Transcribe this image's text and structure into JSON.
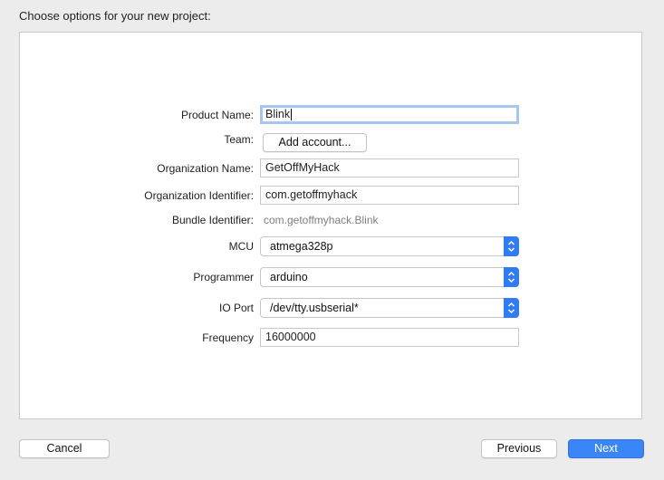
{
  "dialog": {
    "title": "Choose options for your new project:"
  },
  "form": {
    "product_name": {
      "label": "Product Name:",
      "value": "Blink"
    },
    "team": {
      "label": "Team:",
      "button_label": "Add account..."
    },
    "organization_name": {
      "label": "Organization Name:",
      "value": "GetOffMyHack"
    },
    "organization_identifier": {
      "label": "Organization Identifier:",
      "value": "com.getoffmyhack"
    },
    "bundle_identifier": {
      "label": "Bundle Identifier:",
      "value": "com.getoffmyhack.Blink"
    },
    "mcu": {
      "label": "MCU",
      "selected": "atmega328p"
    },
    "programmer": {
      "label": "Programmer",
      "selected": "arduino"
    },
    "io_port": {
      "label": "IO Port",
      "selected": "/dev/tty.usbserial*"
    },
    "frequency": {
      "label": "Frequency",
      "value": "16000000"
    }
  },
  "footer": {
    "cancel_label": "Cancel",
    "previous_label": "Previous",
    "next_label": "Next"
  },
  "colors": {
    "accent": "#3a86f7",
    "focus_ring": "#a7c6ef",
    "window_bg": "#ececec"
  },
  "icons": {
    "popup_arrows": "chevron-up-down-icon"
  }
}
